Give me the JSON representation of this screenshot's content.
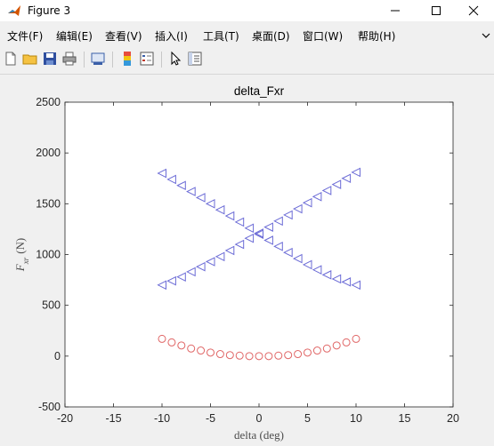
{
  "window": {
    "title": "Figure 3",
    "colors": {
      "accent_icon": "#c0392b"
    }
  },
  "menubar": {
    "items": [
      {
        "label": "文件(F)"
      },
      {
        "label": "编辑(E)"
      },
      {
        "label": "查看(V)"
      },
      {
        "label": "插入(I)"
      },
      {
        "label": "工具(T)"
      },
      {
        "label": "桌面(D)"
      },
      {
        "label": "窗口(W)"
      },
      {
        "label": "帮助(H)"
      }
    ]
  },
  "toolbar": {
    "icons": [
      "new-figure-icon",
      "open-file-icon",
      "save-icon",
      "print-icon",
      "link-plot-icon",
      "insert-colorbar-icon",
      "insert-legend-icon",
      "edit-plot-pointer-icon",
      "property-inspector-icon"
    ]
  },
  "chart_data": {
    "type": "scatter",
    "title": "delta_Fxr",
    "xlabel": "delta (deg)",
    "ylabel_base": "F",
    "ylabel_sub": "xr",
    "ylabel_unit": "(N)",
    "xlim": [
      -20,
      20
    ],
    "ylim": [
      -500,
      2500
    ],
    "xticks": [
      -20,
      -15,
      -10,
      -5,
      0,
      5,
      10,
      15,
      20
    ],
    "yticks": [
      -500,
      0,
      500,
      1000,
      1500,
      2000,
      2500
    ],
    "grid": false,
    "series": [
      {
        "marker": "triangle-left",
        "color": "#6b6bd6",
        "points": [
          [
            -10,
            1800
          ],
          [
            -9,
            1740
          ],
          [
            -8,
            1680
          ],
          [
            -7,
            1620
          ],
          [
            -6,
            1560
          ],
          [
            -5,
            1500
          ],
          [
            -4,
            1440
          ],
          [
            -3,
            1380
          ],
          [
            -2,
            1320
          ],
          [
            -1,
            1260
          ],
          [
            0,
            1200
          ],
          [
            1,
            1140
          ],
          [
            2,
            1080
          ],
          [
            3,
            1020
          ],
          [
            4,
            960
          ],
          [
            5,
            900
          ],
          [
            6,
            850
          ],
          [
            7,
            800
          ],
          [
            8,
            760
          ],
          [
            9,
            730
          ],
          [
            10,
            700
          ]
        ]
      },
      {
        "marker": "triangle-left",
        "color": "#6b6bd6",
        "points": [
          [
            -10,
            700
          ],
          [
            -9,
            740
          ],
          [
            -8,
            780
          ],
          [
            -7,
            830
          ],
          [
            -6,
            880
          ],
          [
            -5,
            930
          ],
          [
            -4,
            980
          ],
          [
            -3,
            1040
          ],
          [
            -2,
            1100
          ],
          [
            -1,
            1160
          ],
          [
            0,
            1210
          ],
          [
            1,
            1270
          ],
          [
            2,
            1330
          ],
          [
            3,
            1390
          ],
          [
            4,
            1450
          ],
          [
            5,
            1510
          ],
          [
            6,
            1570
          ],
          [
            7,
            1630
          ],
          [
            8,
            1690
          ],
          [
            9,
            1750
          ],
          [
            10,
            1810
          ]
        ]
      },
      {
        "marker": "circle",
        "color": "#e06666",
        "points": [
          [
            -10,
            170
          ],
          [
            -9,
            135
          ],
          [
            -8,
            105
          ],
          [
            -7,
            75
          ],
          [
            -6,
            55
          ],
          [
            -5,
            35
          ],
          [
            -4,
            20
          ],
          [
            -3,
            10
          ],
          [
            -2,
            5
          ],
          [
            -1,
            0
          ],
          [
            0,
            0
          ],
          [
            1,
            0
          ],
          [
            2,
            5
          ],
          [
            3,
            10
          ],
          [
            4,
            20
          ],
          [
            5,
            35
          ],
          [
            6,
            55
          ],
          [
            7,
            75
          ],
          [
            8,
            105
          ],
          [
            9,
            135
          ],
          [
            10,
            170
          ]
        ]
      }
    ]
  }
}
